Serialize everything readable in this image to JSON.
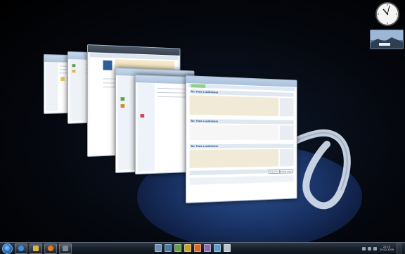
{
  "desktop": {
    "windows": [
      {
        "title": "",
        "app": "explorer"
      },
      {
        "title": "",
        "app": "explorer"
      },
      {
        "title": "",
        "app": "browser"
      },
      {
        "title": "",
        "app": "explorer"
      },
      {
        "title": "",
        "app": "explorer"
      },
      {
        "title": "",
        "app": "browser"
      }
    ],
    "front_window": {
      "posts": [
        {
          "title": "Re: Тема о шаблонах"
        },
        {
          "title": "Re: Тема о шаблонах"
        },
        {
          "title": "Re: Тема о шаблонах"
        }
      ],
      "buttons": [
        "Ответить",
        "Новая тема"
      ]
    }
  },
  "gadgets": {
    "clock": {
      "name": "clock-gadget"
    },
    "slideshow": {
      "name": "slideshow-gadget"
    }
  },
  "taskbar": {
    "pinned": [
      {
        "icon": "internet-explorer-icon",
        "color": "#3a8ee6"
      },
      {
        "icon": "windows-explorer-icon",
        "color": "#d8b54a"
      },
      {
        "icon": "media-player-icon",
        "color": "#e07b24"
      },
      {
        "icon": "window-icon",
        "color": "#7d8a98"
      }
    ],
    "flip_thumbnails": [
      {
        "icon": "window-thumb-1-icon",
        "color": "#6f8fb3"
      },
      {
        "icon": "window-thumb-2-icon",
        "color": "#4e79a8"
      },
      {
        "icon": "window-thumb-3-icon",
        "color": "#6a9c4f"
      },
      {
        "icon": "window-thumb-4-icon",
        "color": "#c9a035"
      },
      {
        "icon": "window-thumb-5-icon",
        "color": "#d36a2e"
      },
      {
        "icon": "window-thumb-6-icon",
        "color": "#8a6fb0"
      },
      {
        "icon": "window-thumb-7-icon",
        "color": "#5d9ec6"
      },
      {
        "icon": "window-thumb-8-icon",
        "color": "#b8c2cc"
      }
    ],
    "tray": {
      "time": "22:15",
      "date": "25.02.2009"
    }
  }
}
